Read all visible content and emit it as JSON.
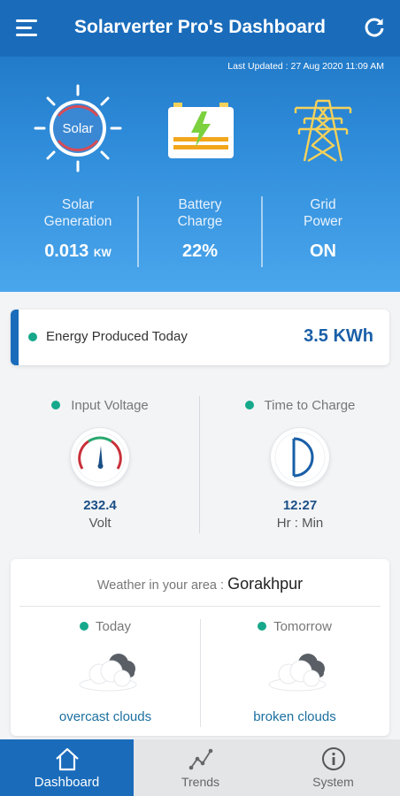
{
  "header": {
    "title": "Solarverter Pro's Dashboard",
    "last_updated": "Last Updated : 27 Aug 2020 11:09 AM"
  },
  "summary": {
    "solar_icon_text": "Solar",
    "solar": {
      "label_line1": "Solar",
      "label_line2": "Generation",
      "value": "0.013",
      "unit": "KW"
    },
    "battery": {
      "label_line1": "Battery",
      "label_line2": "Charge",
      "value": "22%"
    },
    "grid": {
      "label_line1": "Grid",
      "label_line2": "Power",
      "value": "ON"
    }
  },
  "energy": {
    "label": "Energy Produced Today",
    "value": "3.5 KWh"
  },
  "metrics": {
    "voltage": {
      "title": "Input Voltage",
      "value": "232.4",
      "unit": "Volt"
    },
    "charge_time": {
      "title": "Time to Charge",
      "value": "12:27",
      "unit": "Hr : Min"
    }
  },
  "weather": {
    "prefix": "Weather in your area : ",
    "city": "Gorakhpur",
    "today": {
      "label": "Today",
      "condition": "overcast clouds"
    },
    "tomorrow": {
      "label": "Tomorrow",
      "condition": "broken clouds"
    }
  },
  "nav": {
    "items": [
      {
        "label": "Dashboard",
        "icon": "home-icon",
        "active": true
      },
      {
        "label": "Trends",
        "icon": "trends-icon",
        "active": false
      },
      {
        "label": "System",
        "icon": "info-icon",
        "active": false
      }
    ]
  },
  "colors": {
    "primary": "#1a6cbb",
    "accent_green": "#16a88b",
    "value_blue": "#1a4f86"
  }
}
